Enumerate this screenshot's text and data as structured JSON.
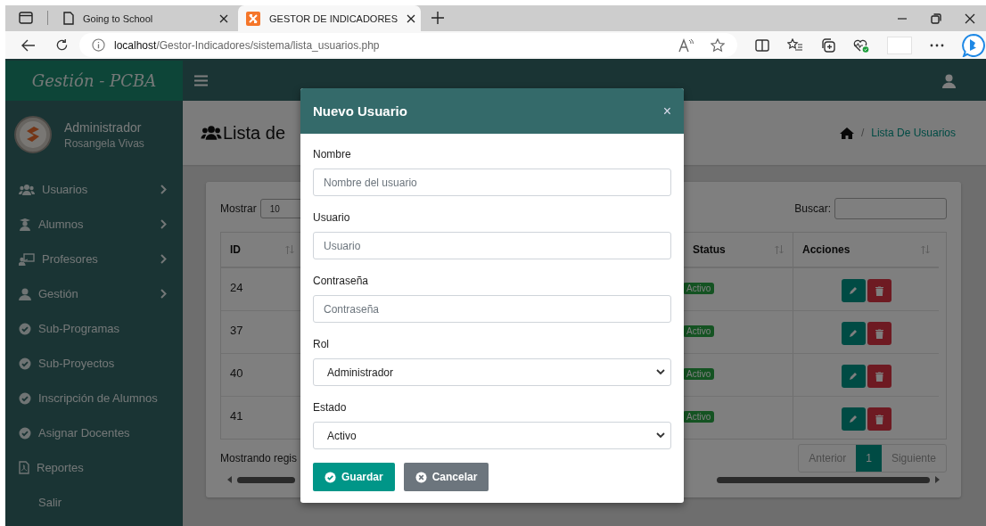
{
  "browser": {
    "tabs": [
      {
        "title": "Going to School",
        "selected": false
      },
      {
        "title": "GESTOR DE INDICADORES",
        "selected": true
      }
    ],
    "address": {
      "host": "localhost",
      "path": "/Gestor-Indicadores/sistema/lista_usuarios.php"
    }
  },
  "sidebar": {
    "brand": "Gestión - PCBA",
    "user": {
      "role": "Administrador",
      "name": "Rosangela Vivas"
    },
    "items": [
      {
        "label": "Usuarios",
        "has_submenu": true
      },
      {
        "label": "Alumnos",
        "has_submenu": true
      },
      {
        "label": "Profesores",
        "has_submenu": true
      },
      {
        "label": "Gestión",
        "has_submenu": true
      },
      {
        "label": "Sub-Programas",
        "has_submenu": false
      },
      {
        "label": "Sub-Proyectos",
        "has_submenu": false
      },
      {
        "label": "Inscripción de Alumnos",
        "has_submenu": false
      },
      {
        "label": "Asignar Docentes",
        "has_submenu": false
      },
      {
        "label": "Reportes",
        "has_submenu": false
      },
      {
        "label": "Salir",
        "has_submenu": false
      }
    ]
  },
  "content": {
    "title": "Lista de",
    "breadcrumb": {
      "separator": "/",
      "current": "Lista De Usuarios"
    }
  },
  "table": {
    "show_label": "Mostrar",
    "page_size": "10",
    "search_label": "Buscar:",
    "columns": [
      {
        "label": "ID"
      },
      {
        "label": "Status"
      },
      {
        "label": "Acciones"
      }
    ],
    "rows": [
      {
        "id": "24",
        "status": "Activo"
      },
      {
        "id": "37",
        "status": "Activo"
      },
      {
        "id": "40",
        "status": "Activo"
      },
      {
        "id": "41",
        "status": "Activo"
      }
    ],
    "footer": "Mostrando regis",
    "pagination": [
      {
        "label": "Anterior",
        "selected": false
      },
      {
        "label": "1",
        "selected": true
      },
      {
        "label": "Siguiente",
        "selected": false
      }
    ]
  },
  "modal": {
    "title": "Nuevo Usuario",
    "close": "×",
    "fields": [
      {
        "kind": "text",
        "label": "Nombre",
        "placeholder": "Nombre del usuario"
      },
      {
        "kind": "text",
        "label": "Usuario",
        "placeholder": "Usuario"
      },
      {
        "kind": "text",
        "label": "Contraseña",
        "placeholder": "Contraseña"
      },
      {
        "kind": "select",
        "label": "Rol",
        "value": "Administrador"
      },
      {
        "kind": "select",
        "label": "Estado",
        "value": "Activo"
      }
    ],
    "buttons": [
      {
        "kind": "primary",
        "label": "Guardar"
      },
      {
        "kind": "secondary",
        "label": "Cancelar"
      }
    ]
  }
}
